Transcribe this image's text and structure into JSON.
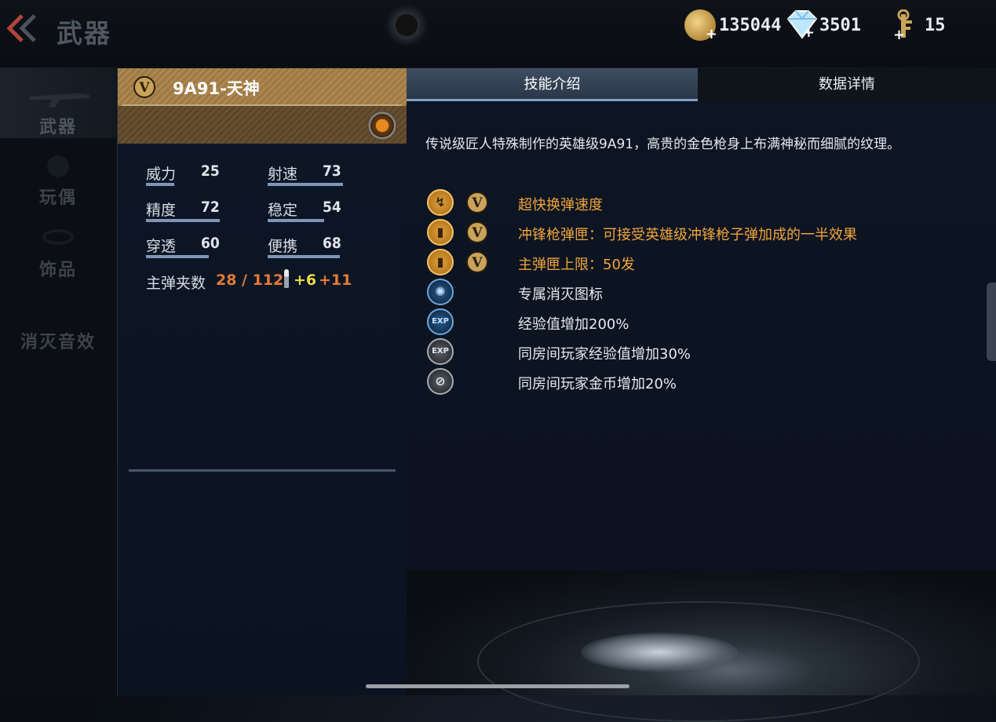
{
  "header": {
    "title": "武器",
    "currencies": [
      {
        "icon": "gold-coin-icon",
        "value": "135044"
      },
      {
        "icon": "diamond-icon",
        "value": "3501"
      },
      {
        "icon": "key-icon",
        "value": "15"
      }
    ]
  },
  "sidebar": {
    "items": [
      {
        "label": "武器",
        "active": true
      },
      {
        "label": "玩偶",
        "active": false
      },
      {
        "label": "饰品",
        "active": false
      },
      {
        "label": "消灭音效",
        "active": false
      }
    ]
  },
  "weapon": {
    "badge": "V",
    "name": "9A91-天神",
    "stats": [
      {
        "label": "威力",
        "value": "25"
      },
      {
        "label": "射速",
        "value": "73"
      },
      {
        "label": "精度",
        "value": "72"
      },
      {
        "label": "稳定",
        "value": "54"
      },
      {
        "label": "穿透",
        "value": "60"
      },
      {
        "label": "便携",
        "value": "68"
      }
    ],
    "ammo": {
      "label": "主弹夹数",
      "value": "28 / 112",
      "bonus1": "+6",
      "bonus2": "+11"
    }
  },
  "tabs": [
    {
      "label": "技能介绍",
      "active": true
    },
    {
      "label": "数据详情",
      "active": false
    }
  ],
  "skills": {
    "description": "传说级匠人特殊制作的英雄级9A91，高贵的金色枪身上布满神秘而细腻的纹理。",
    "items": [
      {
        "icon": "fast-reload-icon",
        "badge": "V",
        "text": "超快换弹速度",
        "color": "#efa53a"
      },
      {
        "icon": "magazine-icon",
        "badge": "V",
        "text": "冲锋枪弹匣：可接受英雄级冲锋枪子弹加成的一半效果",
        "color": "#efa53a"
      },
      {
        "icon": "magazine-icon",
        "badge": "V",
        "text": "主弹匣上限：50发",
        "color": "#efa53a"
      },
      {
        "icon": "kill-icon",
        "badge": "",
        "text": "专属消灭图标",
        "color": "#e6eaee"
      },
      {
        "icon": "exp-icon",
        "badge": "",
        "text": "经验值增加200%",
        "color": "#e6eaee"
      },
      {
        "icon": "room-exp-icon",
        "badge": "",
        "text": "同房间玩家经验值增加30%",
        "color": "#e6eaee"
      },
      {
        "icon": "room-coin-icon",
        "badge": "",
        "text": "同房间玩家金币增加20%",
        "color": "#e6eaee"
      }
    ]
  },
  "colors": {
    "gold_text": "#efa53a",
    "ammo_current": "#e07b39",
    "ammo_bonus": "#e8d84a",
    "tab_active": "#3e4d62",
    "stat_bar": "#7f96b8"
  }
}
